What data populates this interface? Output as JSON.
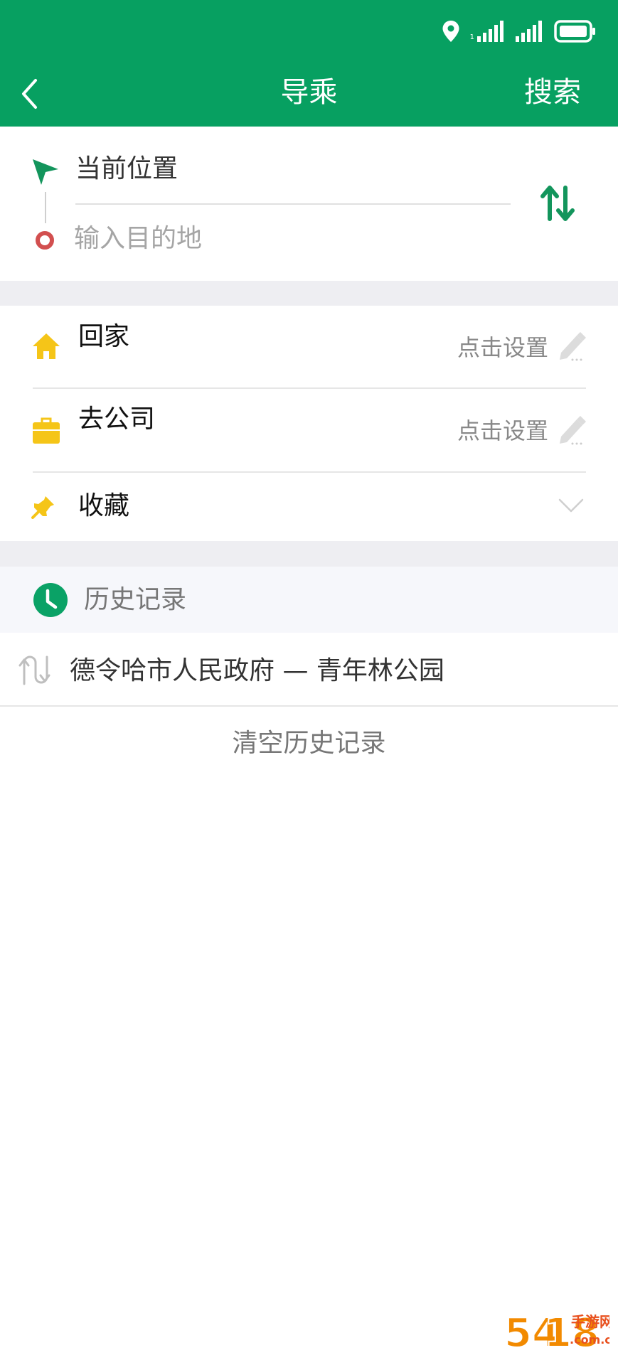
{
  "colors": {
    "brand_green": "#07a061",
    "swap_green": "#13955c",
    "home_yellow": "#f5c518",
    "destination_red": "#d24f4f",
    "clock_green": "#0aa266"
  },
  "status_bar": {
    "icons": [
      "location-icon",
      "signal-icon",
      "signal-icon",
      "battery-icon"
    ],
    "network_label": "1"
  },
  "header": {
    "back_icon": "chevron-left-icon",
    "title": "导乘",
    "search_label": "搜索"
  },
  "route": {
    "origin_icon": "navigation-arrow-icon",
    "origin_text": "当前位置",
    "destination_icon": "destination-ring-icon",
    "destination_placeholder": "输入目的地",
    "destination_value": "",
    "swap_icon": "swap-vertical-icon"
  },
  "shortcuts": [
    {
      "icon": "home-icon",
      "label": "回家",
      "action": "点击设置",
      "action_icon": "pencil-icon"
    },
    {
      "icon": "briefcase-icon",
      "label": "去公司",
      "action": "点击设置",
      "action_icon": "pencil-icon"
    },
    {
      "icon": "pin-icon",
      "label": "收藏",
      "action_icon": "chevron-down-icon"
    }
  ],
  "history": {
    "icon": "clock-icon",
    "title": "历史记录",
    "items": [
      {
        "icon": "route-icon",
        "text": "德令哈市人民政府 — 青年林公园"
      }
    ],
    "clear_label": "清空历史记录"
  },
  "watermark": {
    "brand": "54",
    "brand_suffix": "18",
    "name": "手游网",
    "domain": ".com.cn"
  }
}
